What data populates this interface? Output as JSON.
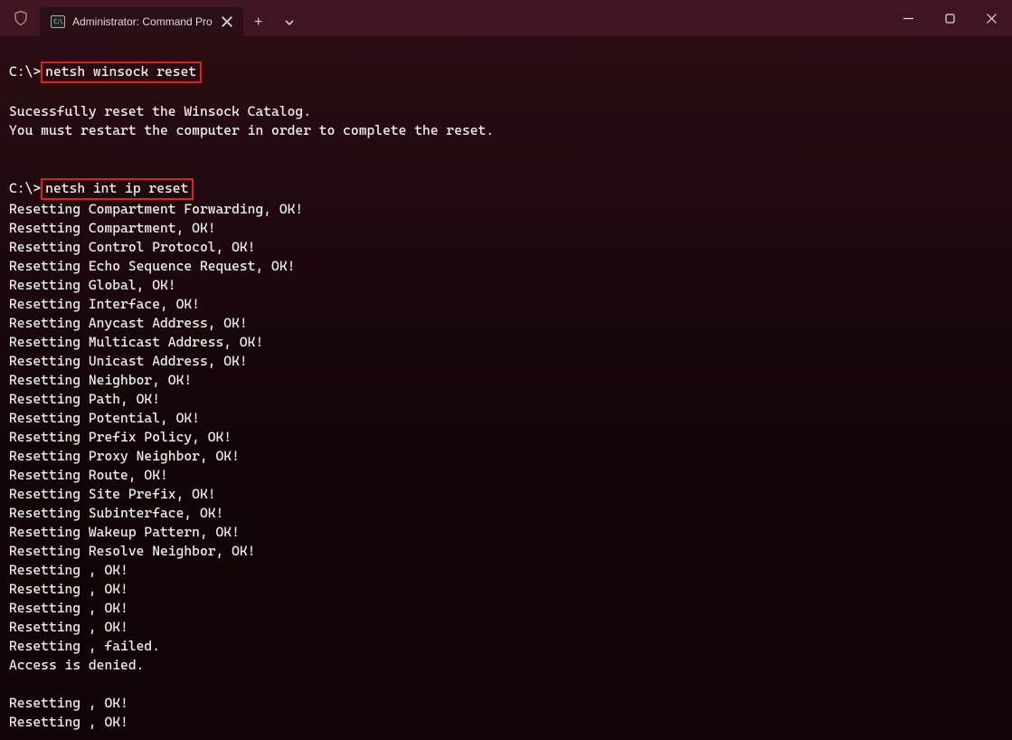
{
  "titlebar": {
    "tab_label": "Administrator: Command Pro",
    "new_tab_glyph": "+",
    "min_glyph": "–"
  },
  "terminal": {
    "prompt": "C:\\>",
    "blocks": [
      {
        "command": "netsh winsock reset",
        "output": [
          "",
          "Sucessfully reset the Winsock Catalog.",
          "You must restart the computer in order to complete the reset.",
          ""
        ]
      },
      {
        "command": "netsh int ip reset",
        "output": [
          "Resetting Compartment Forwarding, OK!",
          "Resetting Compartment, OK!",
          "Resetting Control Protocol, OK!",
          "Resetting Echo Sequence Request, OK!",
          "Resetting Global, OK!",
          "Resetting Interface, OK!",
          "Resetting Anycast Address, OK!",
          "Resetting Multicast Address, OK!",
          "Resetting Unicast Address, OK!",
          "Resetting Neighbor, OK!",
          "Resetting Path, OK!",
          "Resetting Potential, OK!",
          "Resetting Prefix Policy, OK!",
          "Resetting Proxy Neighbor, OK!",
          "Resetting Route, OK!",
          "Resetting Site Prefix, OK!",
          "Resetting Subinterface, OK!",
          "Resetting Wakeup Pattern, OK!",
          "Resetting Resolve Neighbor, OK!",
          "Resetting , OK!",
          "Resetting , OK!",
          "Resetting , OK!",
          "Resetting , OK!",
          "Resetting , failed.",
          "Access is denied.",
          "",
          "Resetting , OK!",
          "Resetting , OK!"
        ]
      }
    ]
  }
}
